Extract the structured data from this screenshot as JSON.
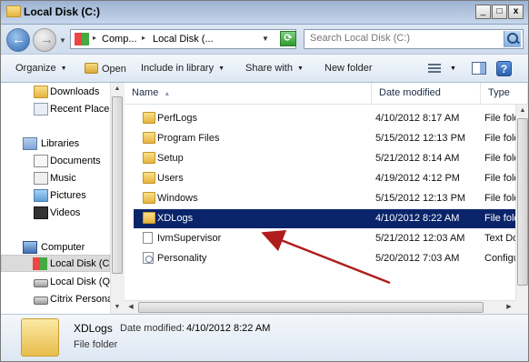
{
  "window": {
    "title": "Local Disk (C:)"
  },
  "address": {
    "crumbs": [
      "Comp...",
      "Local Disk (..."
    ],
    "search_placeholder": "Search Local Disk (C:)"
  },
  "toolbar": {
    "organize": "Organize",
    "open": "Open",
    "include_in_library": "Include in library",
    "share_with": "Share with",
    "new_folder": "New folder"
  },
  "nav": {
    "items": [
      {
        "label": "Downloads",
        "icon": "folder-icon"
      },
      {
        "label": "Recent Places",
        "icon": "recent-places-icon"
      },
      {
        "label": "Libraries",
        "icon": "libraries-icon"
      },
      {
        "label": "Documents",
        "icon": "documents-icon"
      },
      {
        "label": "Music",
        "icon": "music-icon"
      },
      {
        "label": "Pictures",
        "icon": "pictures-icon"
      },
      {
        "label": "Videos",
        "icon": "videos-icon"
      },
      {
        "label": "Computer",
        "icon": "computer-icon"
      },
      {
        "label": "Local Disk (C:)",
        "icon": "local-disk-icon",
        "selected": true
      },
      {
        "label": "Local Disk (Q:)",
        "icon": "disk-icon"
      },
      {
        "label": "Citrix Personal vDisk",
        "icon": "disk-icon"
      }
    ]
  },
  "columns": {
    "name": "Name",
    "date": "Date modified",
    "type": "Type"
  },
  "files": [
    {
      "name": "PerfLogs",
      "date": "4/10/2012 8:17 AM",
      "type": "File folder",
      "icon": "folder"
    },
    {
      "name": "Program Files",
      "date": "5/15/2012 12:13 PM",
      "type": "File folder",
      "icon": "folder"
    },
    {
      "name": "Setup",
      "date": "5/21/2012 8:14 AM",
      "type": "File folder",
      "icon": "folder"
    },
    {
      "name": "Users",
      "date": "4/19/2012 4:12 PM",
      "type": "File folder",
      "icon": "folder"
    },
    {
      "name": "Windows",
      "date": "5/15/2012 12:13 PM",
      "type": "File folder",
      "icon": "folder"
    },
    {
      "name": "XDLogs",
      "date": "4/10/2012 8:22 AM",
      "type": "File folder",
      "icon": "folder",
      "selected": true
    },
    {
      "name": "IvmSupervisor",
      "date": "5/21/2012 12:03 AM",
      "type": "Text Document",
      "icon": "file"
    },
    {
      "name": "Personality",
      "date": "5/20/2012 7:03 AM",
      "type": "Configuration settings",
      "icon": "config"
    }
  ],
  "details": {
    "name": "XDLogs",
    "date_label": "Date modified:",
    "date_value": "4/10/2012 8:22 AM",
    "type": "File folder"
  },
  "colors": {
    "selection": "#0a246a",
    "annotation_arrow": "#b01c1c"
  }
}
